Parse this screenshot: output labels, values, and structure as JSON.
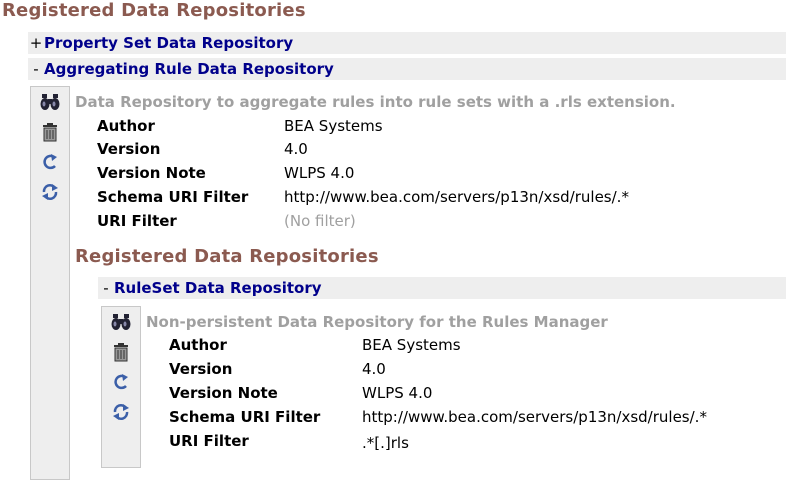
{
  "main_title": "Registered Data Repositories",
  "repos": [
    {
      "toggle": "+",
      "label": "Property Set Data Repository"
    },
    {
      "toggle": "-",
      "label": "Aggregating Rule Data Repository"
    }
  ],
  "aggregating": {
    "description": "Data Repository to aggregate rules into rule sets with a .rls extension.",
    "properties": [
      {
        "label": "Author",
        "value": "BEA Systems"
      },
      {
        "label": "Version",
        "value": "4.0"
      },
      {
        "label": "Version Note",
        "value": "WLPS 4.0"
      },
      {
        "label": "Schema URI Filter",
        "value": "http://www.bea.com/servers/p13n/xsd/rules/.*"
      },
      {
        "label": "URI Filter",
        "value": "(No filter)"
      }
    ]
  },
  "nested": {
    "title": "Registered Data Repositories",
    "repo": {
      "toggle": "-",
      "label": "RuleSet Data Repository"
    },
    "description": "Non-persistent Data Repository for the Rules Manager",
    "properties": [
      {
        "label": "Author",
        "value": "BEA Systems"
      },
      {
        "label": "Version",
        "value": "4.0"
      },
      {
        "label": "Version Note",
        "value": "WLPS 4.0"
      },
      {
        "label": "Schema URI Filter",
        "value": "http://www.bea.com/servers/p13n/xsd/rules/.*"
      },
      {
        "label": "URI Filter",
        "value": ".*[.]rls"
      }
    ]
  },
  "icons": [
    "binoculars-icon",
    "trash-icon",
    "refresh-icon",
    "sync-icon"
  ]
}
